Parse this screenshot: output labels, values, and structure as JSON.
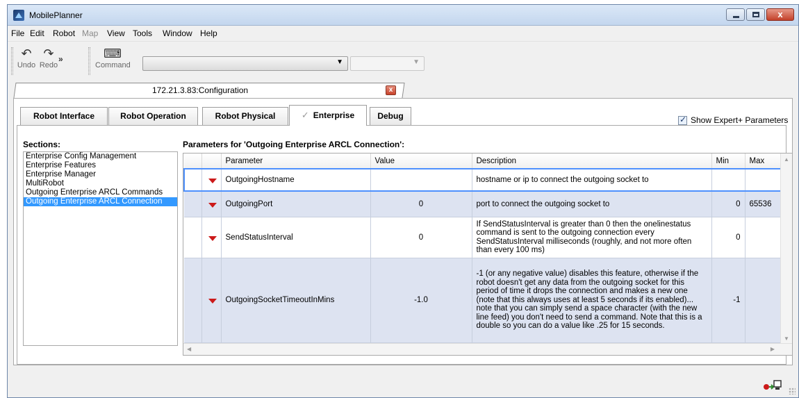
{
  "window": {
    "title": "MobilePlanner",
    "close_glyph": "x"
  },
  "menu": [
    "File",
    "Edit",
    "Robot",
    "Map",
    "View",
    "Tools",
    "Window",
    "Help"
  ],
  "menu_disabled": [
    "Map"
  ],
  "toolbar": {
    "undo_label": "Undo",
    "redo_label": "Redo",
    "command_label": "Command",
    "overflow": "»",
    "combo_value": "",
    "combo2_value": ""
  },
  "document_tab": {
    "label": "172.21.3.83:Configuration",
    "close": "x"
  },
  "tabs": [
    {
      "label": "Robot Interface"
    },
    {
      "label": "Robot Operation"
    },
    {
      "label": "Robot Physical"
    },
    {
      "label": "Enterprise"
    },
    {
      "label": "Debug"
    }
  ],
  "active_tab": "Enterprise",
  "show_expert": {
    "label": "Show Expert+ Parameters",
    "checked": true
  },
  "sections": {
    "title": "Sections:",
    "items": [
      "Enterprise Config Management",
      "Enterprise Features",
      "Enterprise Manager",
      "MultiRobot",
      "Outgoing Enterprise ARCL Commands",
      "Outgoing Enterprise ARCL Connection"
    ],
    "selected": "Outgoing Enterprise ARCL Connection"
  },
  "params": {
    "title": "Parameters for 'Outgoing Enterprise ARCL Connection':",
    "columns": [
      "Parameter",
      "Value",
      "Description",
      "Min",
      "Max"
    ],
    "rows": [
      {
        "name": "OutgoingHostname",
        "value": "",
        "description": "hostname or ip to connect the outgoing socket to",
        "min": "",
        "max": ""
      },
      {
        "name": "OutgoingPort",
        "value": "0",
        "description": "port to connect the outgoing socket to",
        "min": "0",
        "max": "65536"
      },
      {
        "name": "SendStatusInterval",
        "value": "0",
        "description": "If SendStatusInterval is greater than 0 then the onelinestatus command is sent to the outgoing connection every SendStatusInterval milliseconds (roughly, and not more often than every 100 ms)",
        "min": "0",
        "max": ""
      },
      {
        "name": "OutgoingSocketTimeoutInMins",
        "value": "-1.0",
        "description": "-1 (or any negative value) disables this feature, otherwise if the robot doesn't get any data from the outgoing socket for this period of time it drops the connection and makes a new one (note that this always uses at least 5 seconds if its enabled)... note that you can simply send a space character (with the new line feed) you don't need to send a command. Note that this is a double so you can do a value like .25 for 15 seconds.",
        "min": "-1",
        "max": ""
      }
    ]
  },
  "colors": {
    "selection": "#3399ff",
    "row_alt": "#dde3f1",
    "focus": "#4d90fe",
    "flag": "#cc1a1a"
  },
  "icons": [
    "undo-icon",
    "redo-icon",
    "command-icon",
    "dropdown-arrow-icon",
    "checkmark-icon",
    "close-icon",
    "connection-status-icon"
  ]
}
